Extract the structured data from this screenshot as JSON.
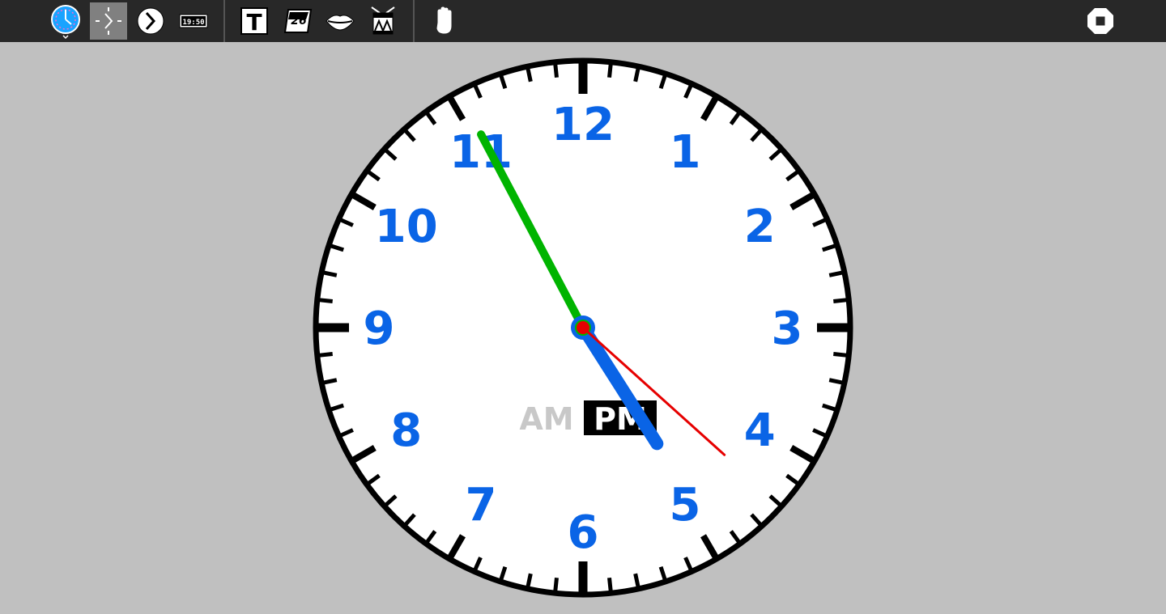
{
  "toolbar": {
    "buttons": [
      {
        "name": "activity-clock-icon",
        "active": false
      },
      {
        "name": "simple-clock-icon",
        "active": true
      },
      {
        "name": "nice-clock-icon",
        "active": false
      },
      {
        "name": "digital-clock-icon",
        "active": false
      },
      {
        "name": "text-time-icon",
        "active": false
      },
      {
        "name": "date-icon",
        "active": false
      },
      {
        "name": "speak-time-icon",
        "active": false
      },
      {
        "name": "alarm-drum-icon",
        "active": false
      },
      {
        "name": "grab-hands-icon",
        "active": false
      },
      {
        "name": "stop-icon",
        "active": false
      }
    ],
    "text_button_glyph": "T",
    "date_glyph": "26",
    "digital_glyph": "19:50"
  },
  "clock": {
    "numbers": [
      "12",
      "1",
      "2",
      "3",
      "4",
      "5",
      "6",
      "7",
      "8",
      "9",
      "10",
      "11"
    ],
    "am_label": "AM",
    "pm_label": "PM",
    "active_period": "PM",
    "time": {
      "hour": 16,
      "minute": 55,
      "second": 22
    },
    "colors": {
      "face": "#ffffff",
      "rim": "#000000",
      "numbers": "#0a64e6",
      "hour_hand": "#0a64e6",
      "minute_hand": "#00b400",
      "second_hand": "#e60000",
      "am_inactive": "#c8c8c8",
      "pm_bg": "#000000",
      "pm_text": "#ffffff"
    }
  }
}
